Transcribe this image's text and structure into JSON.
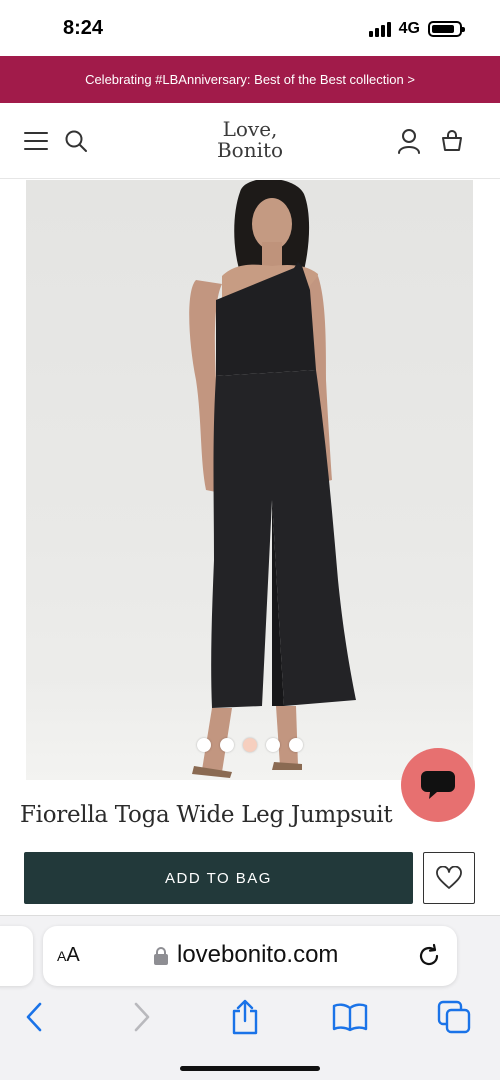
{
  "status_bar": {
    "time": "8:24",
    "network": "4G",
    "battery_level": 0.85
  },
  "promo_banner": {
    "text": "Celebrating #LBAnniversary: Best of the Best collection >",
    "background_color": "#a11b4a"
  },
  "header": {
    "logo_line1": "Love,",
    "logo_line2": "Bonito",
    "icons": [
      "menu-icon",
      "search-icon",
      "account-icon",
      "bag-icon"
    ]
  },
  "gallery": {
    "image_count": 5,
    "active_index": 2
  },
  "chat": {
    "icon": "chat-bubble-icon",
    "color": "#e77070"
  },
  "product": {
    "title": "Fiorella Toga Wide Leg Jumpsuit",
    "add_to_bag_label": "ADD TO BAG",
    "button_color": "#22393a",
    "wishlist_icon": "heart-icon"
  },
  "browser": {
    "text_size_label_big": "A",
    "text_size_label_small": "A",
    "url": "lovebonito.com",
    "toolbar_icons": [
      "back-icon",
      "forward-icon",
      "share-icon",
      "bookmarks-icon",
      "tabs-icon"
    ]
  }
}
